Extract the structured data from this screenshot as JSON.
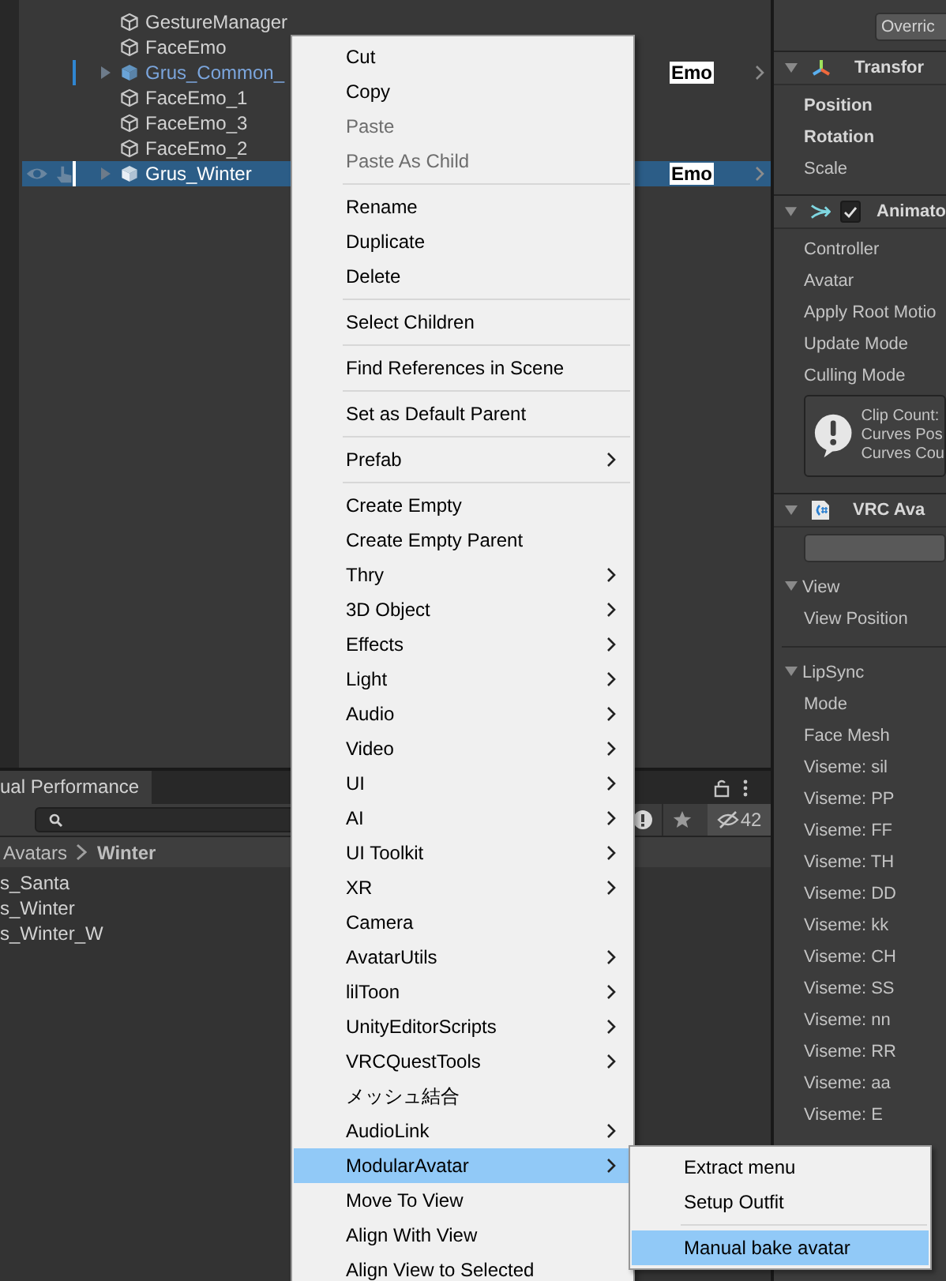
{
  "hierarchy": {
    "rows": [
      {
        "name": "GestureManager",
        "kind": "object",
        "selected": false
      },
      {
        "name": "FaceEmo",
        "kind": "object",
        "selected": false
      },
      {
        "name": "Grus_Common_",
        "kind": "prefab",
        "selected": false,
        "tag": "Emo"
      },
      {
        "name": "FaceEmo_1",
        "kind": "object",
        "selected": false
      },
      {
        "name": "FaceEmo_3",
        "kind": "object",
        "selected": false
      },
      {
        "name": "FaceEmo_2",
        "kind": "object",
        "selected": false
      },
      {
        "name": "Grus_Winter",
        "kind": "prefab",
        "selected": true,
        "tag": "Emo"
      }
    ]
  },
  "project": {
    "tab_title": "ual Performance",
    "hidden_count": "42",
    "breadcrumb": [
      "Avatars",
      "Winter"
    ],
    "items": [
      "s_Santa",
      "s_Winter",
      "s_Winter_W"
    ]
  },
  "inspector": {
    "rows": [
      {
        "kind": "button",
        "label": "Overric"
      },
      {
        "kind": "header",
        "title": "Transfor"
      },
      {
        "kind": "prop",
        "label": "Position",
        "overridden": true
      },
      {
        "kind": "prop",
        "label": "Rotation",
        "overridden": true
      },
      {
        "kind": "prop",
        "label": "Scale",
        "overridden": false
      },
      {
        "kind": "header",
        "title": "Animato",
        "checked": true
      },
      {
        "kind": "prop",
        "label": "Controller",
        "overridden": false
      },
      {
        "kind": "prop",
        "label": "Avatar",
        "overridden": false
      },
      {
        "kind": "prop",
        "label": "Apply Root Motio",
        "overridden": false
      },
      {
        "kind": "prop",
        "label": "Update Mode",
        "overridden": false
      },
      {
        "kind": "prop",
        "label": "Culling Mode",
        "overridden": false
      },
      {
        "kind": "help",
        "lines": [
          "Clip Count:",
          "Curves Pos",
          "Curves Cou"
        ]
      },
      {
        "kind": "header",
        "title": "VRC Ava"
      },
      {
        "kind": "input"
      },
      {
        "kind": "foldout",
        "label": "View",
        "expanded": true
      },
      {
        "kind": "prop",
        "label": "View Position",
        "overridden": false
      },
      {
        "kind": "divider"
      },
      {
        "kind": "foldout",
        "label": "LipSync",
        "expanded": true
      },
      {
        "kind": "prop",
        "label": "Mode",
        "overridden": false
      },
      {
        "kind": "prop",
        "label": "Face Mesh",
        "overridden": false
      },
      {
        "kind": "prop",
        "label": "Viseme: sil",
        "overridden": false
      },
      {
        "kind": "prop",
        "label": "Viseme: PP",
        "overridden": false
      },
      {
        "kind": "prop",
        "label": "Viseme: FF",
        "overridden": false
      },
      {
        "kind": "prop",
        "label": "Viseme: TH",
        "overridden": false
      },
      {
        "kind": "prop",
        "label": "Viseme: DD",
        "overridden": false
      },
      {
        "kind": "prop",
        "label": "Viseme: kk",
        "overridden": false
      },
      {
        "kind": "prop",
        "label": "Viseme: CH",
        "overridden": false
      },
      {
        "kind": "prop",
        "label": "Viseme: SS",
        "overridden": false
      },
      {
        "kind": "prop",
        "label": "Viseme: nn",
        "overridden": false
      },
      {
        "kind": "prop",
        "label": "Viseme: RR",
        "overridden": false
      },
      {
        "kind": "prop",
        "label": "Viseme: aa",
        "overridden": false
      },
      {
        "kind": "prop",
        "label": "Viseme: E",
        "overridden": false
      }
    ]
  },
  "context_menu": {
    "items": [
      {
        "kind": "item",
        "label": "Cut",
        "disabled": false,
        "submenu": false,
        "selected": false
      },
      {
        "kind": "item",
        "label": "Copy",
        "disabled": false,
        "submenu": false,
        "selected": false
      },
      {
        "kind": "item",
        "label": "Paste",
        "disabled": true,
        "submenu": false,
        "selected": false
      },
      {
        "kind": "item",
        "label": "Paste As Child",
        "disabled": true,
        "submenu": false,
        "selected": false
      },
      {
        "kind": "separator"
      },
      {
        "kind": "item",
        "label": "Rename",
        "disabled": false,
        "submenu": false,
        "selected": false
      },
      {
        "kind": "item",
        "label": "Duplicate",
        "disabled": false,
        "submenu": false,
        "selected": false
      },
      {
        "kind": "item",
        "label": "Delete",
        "disabled": false,
        "submenu": false,
        "selected": false
      },
      {
        "kind": "separator"
      },
      {
        "kind": "item",
        "label": "Select Children",
        "disabled": false,
        "submenu": false,
        "selected": false
      },
      {
        "kind": "separator"
      },
      {
        "kind": "item",
        "label": "Find References in Scene",
        "disabled": false,
        "submenu": false,
        "selected": false
      },
      {
        "kind": "separator"
      },
      {
        "kind": "item",
        "label": "Set as Default Parent",
        "disabled": false,
        "submenu": false,
        "selected": false
      },
      {
        "kind": "separator"
      },
      {
        "kind": "item",
        "label": "Prefab",
        "disabled": false,
        "submenu": true,
        "selected": false
      },
      {
        "kind": "separator"
      },
      {
        "kind": "item",
        "label": "Create Empty",
        "disabled": false,
        "submenu": false,
        "selected": false
      },
      {
        "kind": "item",
        "label": "Create Empty Parent",
        "disabled": false,
        "submenu": false,
        "selected": false
      },
      {
        "kind": "item",
        "label": "Thry",
        "disabled": false,
        "submenu": true,
        "selected": false
      },
      {
        "kind": "item",
        "label": "3D Object",
        "disabled": false,
        "submenu": true,
        "selected": false
      },
      {
        "kind": "item",
        "label": "Effects",
        "disabled": false,
        "submenu": true,
        "selected": false
      },
      {
        "kind": "item",
        "label": "Light",
        "disabled": false,
        "submenu": true,
        "selected": false
      },
      {
        "kind": "item",
        "label": "Audio",
        "disabled": false,
        "submenu": true,
        "selected": false
      },
      {
        "kind": "item",
        "label": "Video",
        "disabled": false,
        "submenu": true,
        "selected": false
      },
      {
        "kind": "item",
        "label": "UI",
        "disabled": false,
        "submenu": true,
        "selected": false
      },
      {
        "kind": "item",
        "label": "AI",
        "disabled": false,
        "submenu": true,
        "selected": false
      },
      {
        "kind": "item",
        "label": "UI Toolkit",
        "disabled": false,
        "submenu": true,
        "selected": false
      },
      {
        "kind": "item",
        "label": "XR",
        "disabled": false,
        "submenu": true,
        "selected": false
      },
      {
        "kind": "item",
        "label": "Camera",
        "disabled": false,
        "submenu": false,
        "selected": false
      },
      {
        "kind": "item",
        "label": "AvatarUtils",
        "disabled": false,
        "submenu": true,
        "selected": false
      },
      {
        "kind": "item",
        "label": "lilToon",
        "disabled": false,
        "submenu": true,
        "selected": false
      },
      {
        "kind": "item",
        "label": "UnityEditorScripts",
        "disabled": false,
        "submenu": true,
        "selected": false
      },
      {
        "kind": "item",
        "label": "VRCQuestTools",
        "disabled": false,
        "submenu": true,
        "selected": false
      },
      {
        "kind": "item",
        "label": "メッシュ結合",
        "disabled": false,
        "submenu": false,
        "selected": false
      },
      {
        "kind": "item",
        "label": "AudioLink",
        "disabled": false,
        "submenu": true,
        "selected": false
      },
      {
        "kind": "item",
        "label": "ModularAvatar",
        "disabled": false,
        "submenu": true,
        "selected": true
      },
      {
        "kind": "item",
        "label": "Move To View",
        "disabled": false,
        "submenu": false,
        "selected": false
      },
      {
        "kind": "item",
        "label": "Align With View",
        "disabled": false,
        "submenu": false,
        "selected": false
      },
      {
        "kind": "item",
        "label": "Align View to Selected",
        "disabled": false,
        "submenu": false,
        "selected": false
      }
    ]
  },
  "submenu": {
    "items": [
      {
        "kind": "item",
        "label": "Extract menu",
        "disabled": false,
        "submenu": false,
        "selected": false
      },
      {
        "kind": "item",
        "label": "Setup Outfit",
        "disabled": false,
        "submenu": false,
        "selected": false
      },
      {
        "kind": "separator"
      },
      {
        "kind": "item",
        "label": "Manual bake avatar",
        "disabled": false,
        "submenu": false,
        "selected": true
      }
    ]
  }
}
